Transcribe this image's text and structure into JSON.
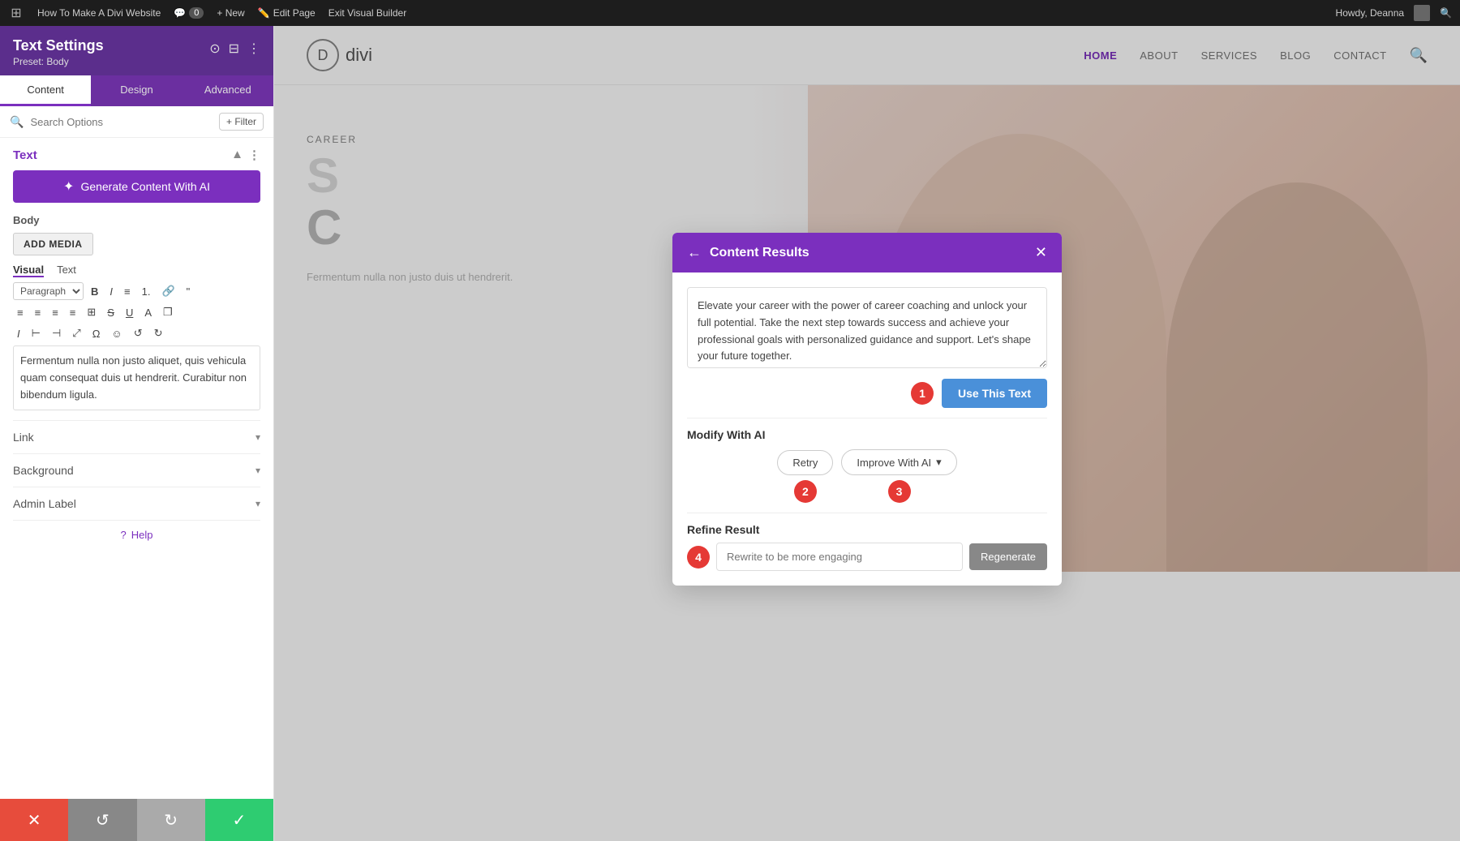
{
  "adminBar": {
    "siteName": "How To Make A Divi Website",
    "commentCount": "0",
    "newLabel": "+ New",
    "editPageLabel": "Edit Page",
    "exitBuilderLabel": "Exit Visual Builder",
    "userLabel": "Howdy, Deanna"
  },
  "sidebar": {
    "title": "Text Settings",
    "preset": "Preset: Body",
    "tabs": [
      {
        "label": "Content",
        "active": true
      },
      {
        "label": "Design",
        "active": false
      },
      {
        "label": "Advanced",
        "active": false
      }
    ],
    "searchPlaceholder": "Search Options",
    "filterLabel": "+ Filter",
    "sectionTitle": "Text",
    "aiButtonLabel": "Generate Content With AI",
    "bodyLabel": "Body",
    "addMediaLabel": "ADD MEDIA",
    "editorTabs": [
      "Visual",
      "Text"
    ],
    "editorContent": "Fermentum nulla non justo aliquet, quis vehicula quam consequat duis ut hendrerit. Curabitur non bibendum ligula.",
    "sections": [
      {
        "label": "Link"
      },
      {
        "label": "Background"
      },
      {
        "label": "Admin Label"
      }
    ],
    "helpLabel": "Help"
  },
  "bottomBar": {
    "cancelIcon": "✕",
    "undoIcon": "↺",
    "redoIcon": "↻",
    "confirmIcon": "✓"
  },
  "siteNav": {
    "logoLetter": "D",
    "logoText": "divi",
    "links": [
      {
        "label": "HOME",
        "active": true
      },
      {
        "label": "ABOUT",
        "active": false
      },
      {
        "label": "SERVICES",
        "active": false
      },
      {
        "label": "BLOG",
        "active": false
      },
      {
        "label": "CONTACT",
        "active": false
      }
    ]
  },
  "hero": {
    "careerLabel": "CAREER",
    "title": "S",
    "subtitle": "C",
    "bodyText": "Fermentum nulla non justo duis ut hendrerit."
  },
  "modal": {
    "title": "Content Results",
    "backIcon": "←",
    "closeIcon": "✕",
    "generatedText": "Elevate your career with the power of career coaching and unlock your full potential. Take the next step towards success and achieve your professional goals with personalized guidance and support. Let's shape your future together.",
    "useThisTextLabel": "Use This Text",
    "badge1": "1",
    "modifyLabel": "Modify With AI",
    "retryLabel": "Retry",
    "improveLabel": "Improve With AI",
    "improveIcon": "▾",
    "badge2": "2",
    "badge3": "3",
    "refineLabel": "Refine Result",
    "refinePlaceholder": "Rewrite to be more engaging",
    "regenerateLabel": "Regenerate",
    "badge4": "4"
  },
  "floatingDots": "•••"
}
